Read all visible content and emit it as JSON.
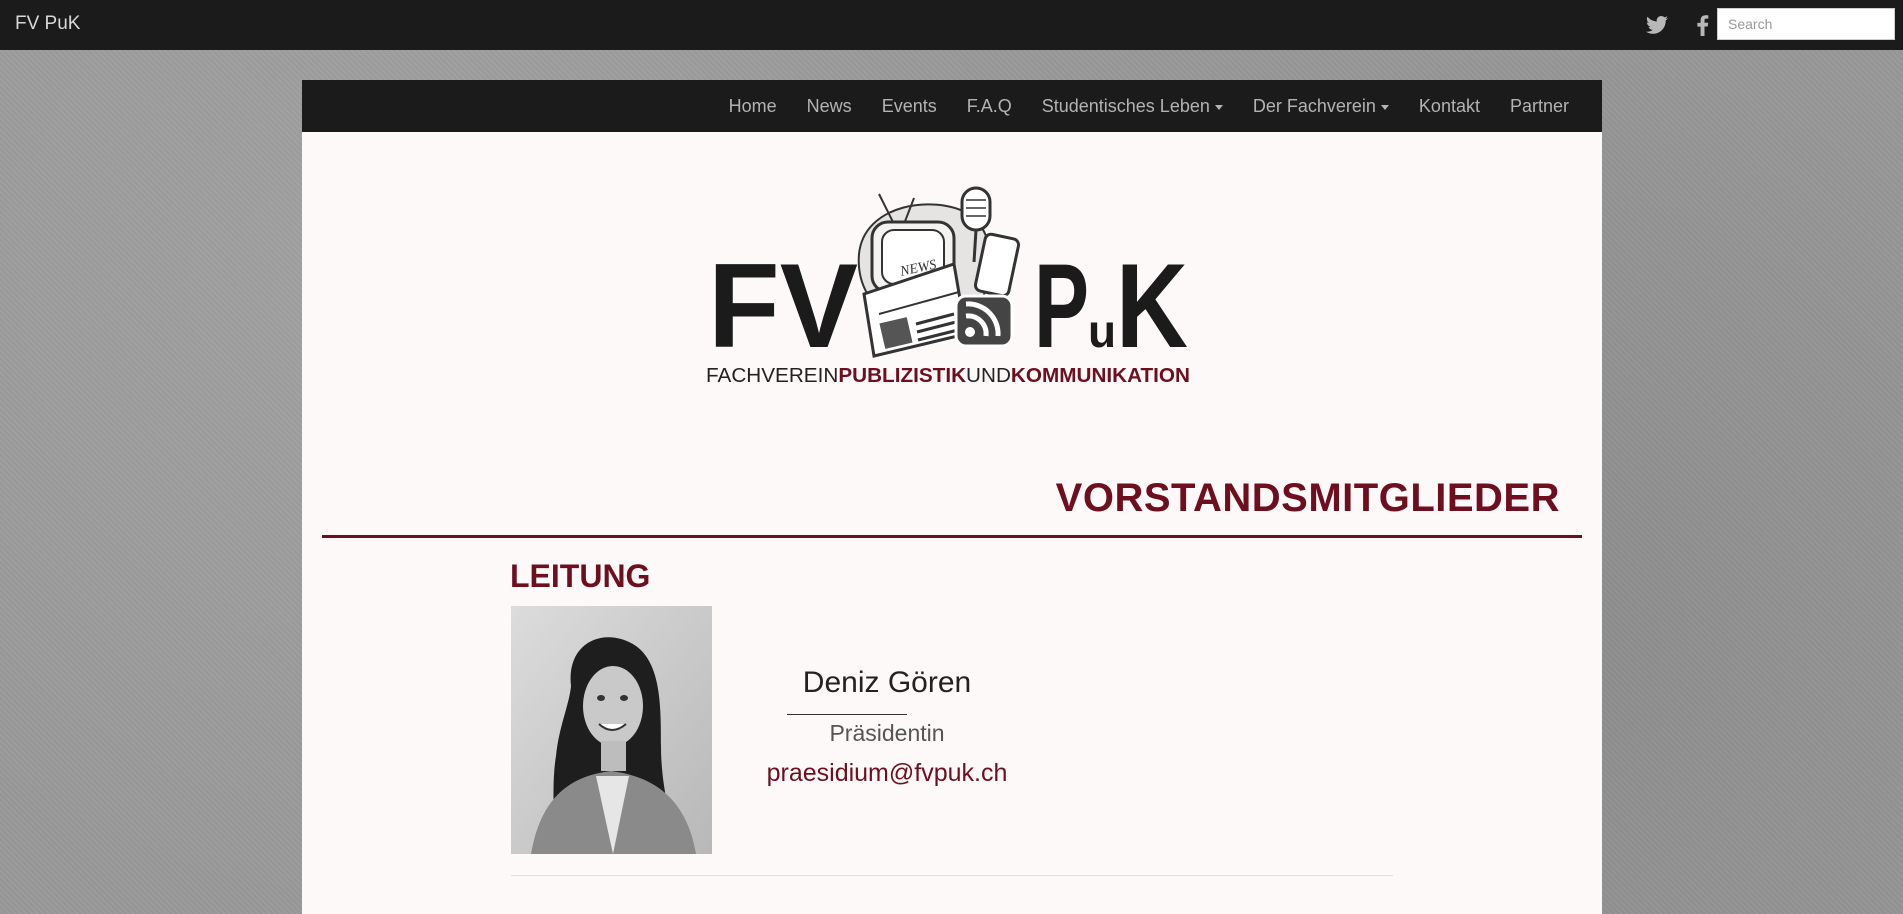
{
  "topbar": {
    "brand": "FV PuK",
    "social": [
      "twitter-icon",
      "facebook-icon"
    ],
    "search_placeholder": "Search"
  },
  "nav": {
    "items": [
      {
        "label": "Home",
        "dropdown": false
      },
      {
        "label": "News",
        "dropdown": false
      },
      {
        "label": "Events",
        "dropdown": false
      },
      {
        "label": "F.A.Q",
        "dropdown": false
      },
      {
        "label": "Studentisches Leben",
        "dropdown": true
      },
      {
        "label": "Der Fachverein",
        "dropdown": true
      },
      {
        "label": "Kontakt",
        "dropdown": false
      },
      {
        "label": "Partner",
        "dropdown": false
      }
    ]
  },
  "logo": {
    "letters_left": "FV",
    "letters_p": "P",
    "letters_u": "u",
    "letters_k": "K",
    "news_label": "NEWS",
    "tagline_1": "FACHVEREIN",
    "tagline_2": "PUBLIZISTIK",
    "tagline_3": "UND",
    "tagline_4": "KOMMUNIKATION"
  },
  "page": {
    "title": "VORSTANDSMITGLIEDER",
    "section": "LEITUNG"
  },
  "member": {
    "name": "Deniz Gören",
    "role": "Präsidentin",
    "email": "praesidium@fvpuk.ch"
  },
  "colors": {
    "accent": "#6e0f1f",
    "navbar": "#1b1b1b",
    "content_bg": "#fdf9f8"
  }
}
